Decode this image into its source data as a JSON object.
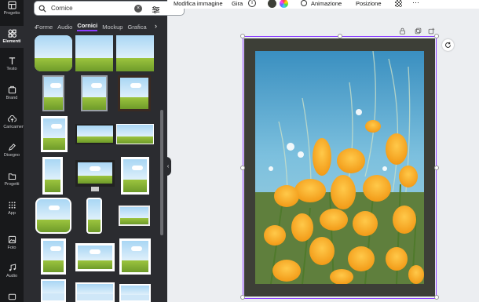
{
  "rail": {
    "items": [
      {
        "label": "Progetto",
        "icon": "layout-icon"
      },
      {
        "label": "Elementi",
        "icon": "shapes-icon"
      },
      {
        "label": "Testo",
        "icon": "text-icon"
      },
      {
        "label": "Brand",
        "icon": "brand-icon"
      },
      {
        "label": "Caricamenti",
        "icon": "upload-icon"
      },
      {
        "label": "Disegno",
        "icon": "pen-icon"
      },
      {
        "label": "Progetti",
        "icon": "folder-icon"
      },
      {
        "label": "App",
        "icon": "apps-icon"
      },
      {
        "label": "Foto",
        "icon": "photo-icon"
      },
      {
        "label": "Audio",
        "icon": "audio-icon"
      }
    ]
  },
  "search": {
    "value": "Cornice",
    "placeholder": ""
  },
  "tabs": {
    "items": [
      "Forme",
      "Audio",
      "Cornici",
      "Mockup",
      "Grafica"
    ],
    "active": "Cornici"
  },
  "toolbar": {
    "edit_image": "Modifica immagine",
    "flip": "Gira",
    "animate": "Animazione",
    "position": "Posizione"
  },
  "colors": {
    "accent": "#8b3dff",
    "frame": "#3d3f37",
    "rail": "#18191b",
    "panel": "#2b2c30"
  }
}
